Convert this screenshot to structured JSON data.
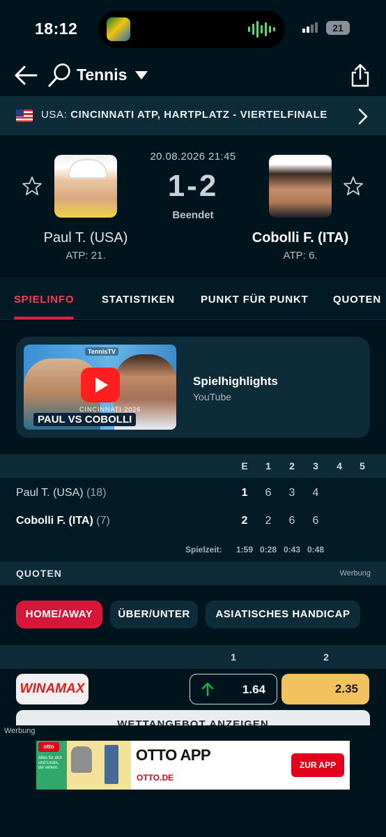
{
  "status_bar": {
    "time": "18:12",
    "battery": "21"
  },
  "header": {
    "title": "Tennis"
  },
  "competition": {
    "country": "USA:",
    "name": "CINCINNATI ATP, HARTPLATZ - VIERTELFINALE"
  },
  "match": {
    "datetime": "20.08.2026 21:45",
    "score": "1-2",
    "status": "Beendet",
    "home": {
      "name": "Paul T. (USA)",
      "rank": "ATP: 21."
    },
    "away": {
      "name": "Cobolli F. (ITA)",
      "rank": "ATP: 6."
    }
  },
  "tabs": [
    "SPIELINFO",
    "STATISTIKEN",
    "PUNKT FÜR PUNKT",
    "QUOTEN"
  ],
  "highlight": {
    "title": "Spielhighlights",
    "source": "YouTube",
    "thumb_badge": "TennisTV",
    "thumb_event": "CINCINNATI 2026",
    "thumb_title": "PAUL VS COBOLLI"
  },
  "scoreboard": {
    "columns": [
      "E",
      "1",
      "2",
      "3",
      "4",
      "5"
    ],
    "rows": [
      {
        "name": "Paul T. (USA)",
        "seed": "(18)",
        "total": "1",
        "sets": [
          "6",
          "3",
          "4",
          "",
          ""
        ]
      },
      {
        "name": "Cobolli F. (ITA)",
        "seed": "(7)",
        "total": "2",
        "sets": [
          "2",
          "6",
          "6",
          "",
          ""
        ]
      }
    ],
    "playtime_label": "Spielzeit:",
    "playtimes": [
      "1:59",
      "0:28",
      "0:43",
      "0:48"
    ]
  },
  "odds": {
    "title": "QUOTEN",
    "ad_label": "Werbung",
    "pills": [
      "HOME/AWAY",
      "ÜBER/UNTER",
      "ASIATISCHES HANDICAP"
    ],
    "columns": [
      "1",
      "2"
    ],
    "bookmaker": "WINAMAX",
    "home_odd": "1.64",
    "away_odd": "2.35",
    "offer_button": "WETTANGEBOT ANZEIGEN",
    "colors": {
      "home_trend": "#1fb141",
      "away_highlight": "#f2c25e",
      "accent": "#d6173a"
    }
  },
  "ad": {
    "label": "Werbung",
    "brand_logo": "otto",
    "side_text": "Alles für dich und Looks, die wirken.",
    "title": "OTTO APP",
    "url": "OTTO.DE",
    "cta": "ZUR APP"
  }
}
